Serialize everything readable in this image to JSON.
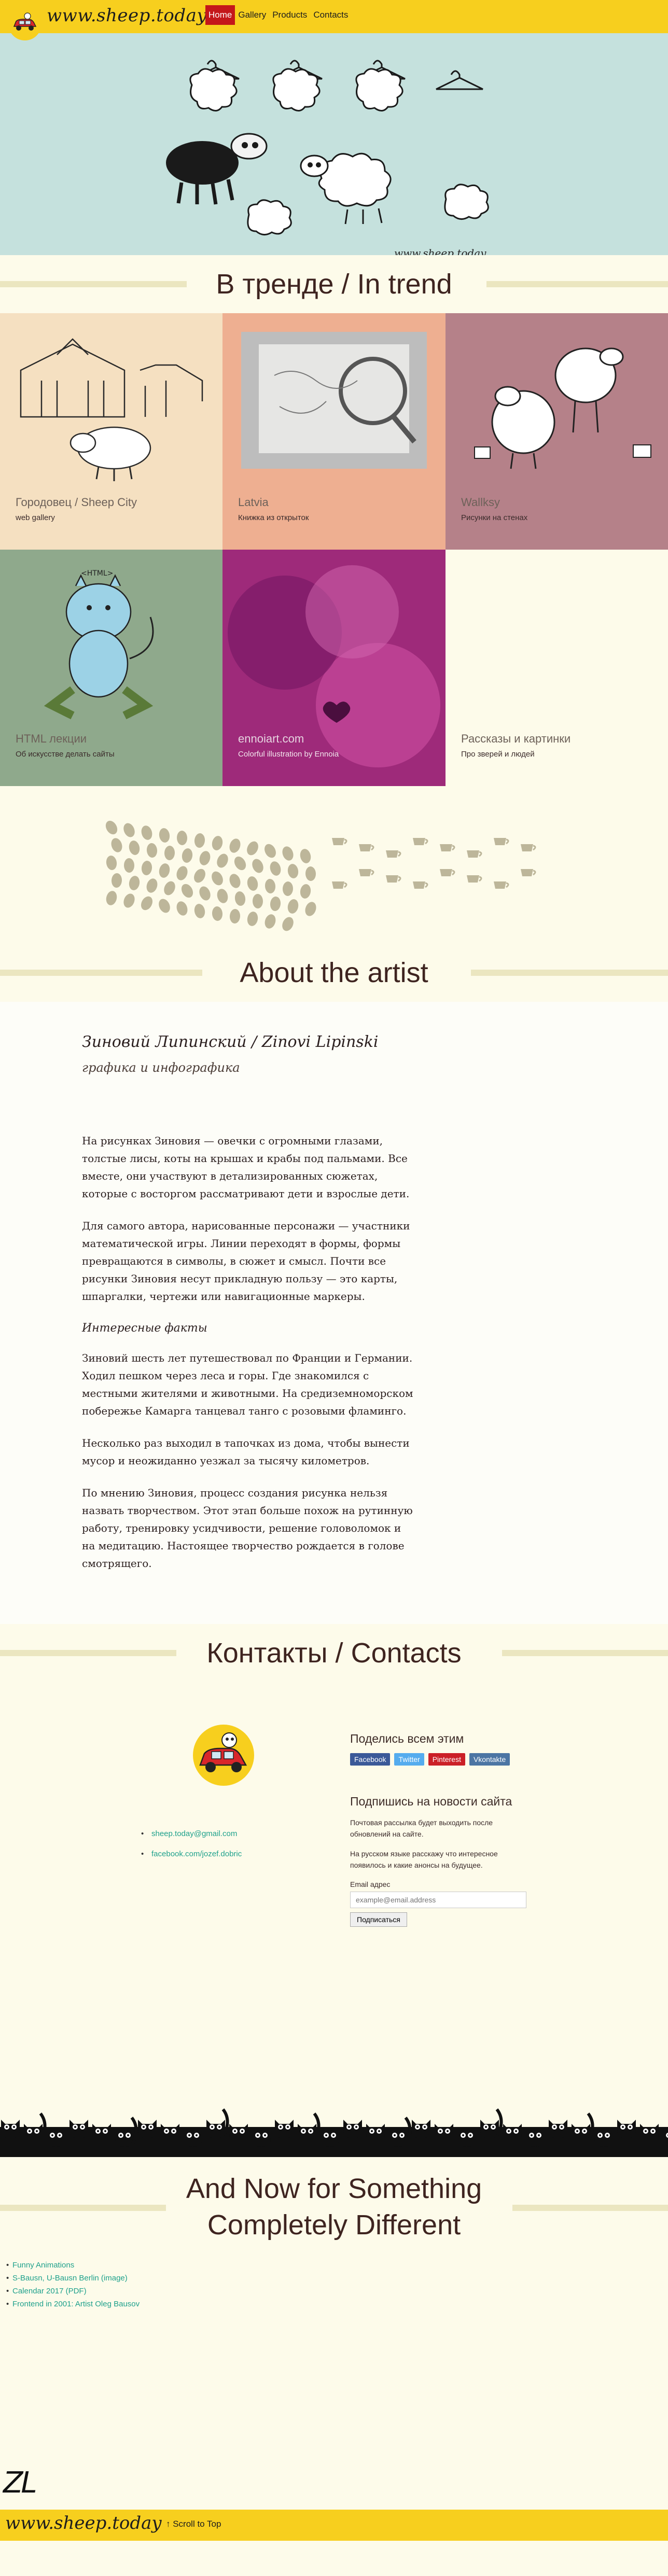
{
  "nav": {
    "logo": "www.sheep.today",
    "items": [
      {
        "label": "Home",
        "active": true
      },
      {
        "label": "Gallery",
        "active": false
      },
      {
        "label": "Products",
        "active": false
      },
      {
        "label": "Contacts",
        "active": false
      }
    ]
  },
  "hero": {
    "url_text": "www.sheep.today"
  },
  "trend": {
    "heading": "В тренде / In trend",
    "tiles": [
      {
        "title": "Городовец / Sheep City",
        "sub": "web gallery"
      },
      {
        "title": "Latvia",
        "sub": "Книжка из открыток"
      },
      {
        "title": "Wallksy",
        "sub": "Рисунки на стенах"
      },
      {
        "title": "HTML лекции",
        "sub": "Об искусстве делать сайты"
      },
      {
        "title": "ennoiart.com",
        "sub": "Colorful illustration by Ennoia"
      },
      {
        "title": "Рассказы и картинки",
        "sub": "Про зверей и людей"
      }
    ]
  },
  "about": {
    "heading": "About the artist",
    "name": "Зиновий Липинский / Zinovi Lipinski",
    "subtitle": "графика и инфографика",
    "p1": "На рисунках Зиновия — овечки с огромными глазами, толстые лисы, коты на крышах и крабы под пальмами. Все вместе, они участвуют в детализированных сюжетах, которые с восторгом рассматривают дети и взрослые дети.",
    "p2": "Для самого автора, нарисованные персонажи — участники математической игры. Линии переходят в формы, формы превращаются в символы, в сюжет и смысл. Почти все рисунки Зиновия несут прикладную пользу — это карты, шпаргалки, чертежи или навигационные маркеры.",
    "facts_heading": "Интересные факты",
    "p3": "Зиновий шесть лет путешествовал по Франции и Германии. Ходил пешком через леса и горы. Где знакомился с местными жителями и животными. На средиземноморском побережье Камарга танцевал танго с розовыми фламинго.",
    "p4": "Несколько раз выходил в тапочках из дома, чтобы вынести мусор и неожиданно уезжал за тысячу километров.",
    "p5": "По мнению Зиновия, процесс создания рисунка нельзя назвать творчеством. Этот этап больше похож на рутинную работу, тренировку усидчивости, решение головоломок и на медитацию. Настоящее творчество рождается в голове смотрящего."
  },
  "contacts": {
    "heading": "Контакты / Contacts",
    "links": [
      "sheep.today@gmail.com",
      "facebook.com/jozef.dobric"
    ],
    "share_heading": "Поделись всем этим",
    "share_buttons": {
      "fb": "Facebook",
      "tw": "Twitter",
      "pi": "Pinterest",
      "vk": "Vkontakte"
    },
    "subscribe_heading": "Подпишись на новости сайта",
    "note1": "Почтовая рассылка будет выходить после обновлений на сайте.",
    "note2": "На русском языке расскажу что интересное появилось и какие анонсы на будущее.",
    "email_label": "Email адрес",
    "email_placeholder": "example@email.address",
    "submit": "Подписаться"
  },
  "different": {
    "heading_line1": "And Now for Something",
    "heading_line2": "Completely Different",
    "links": [
      "Funny Animations",
      "S-Bausn, U-Bausn Berlin (image)",
      "Calendar 2017 (PDF)",
      "Frontend in 2001: Artist Oleg Bausov"
    ],
    "signature": "ZL"
  },
  "footer": {
    "logo": "www.sheep.today",
    "scroll_top": "↑ Scroll to Top"
  },
  "colors": {
    "accent_yellow": "#f7cf1e",
    "active_red": "#c4171a",
    "link_teal": "#1fa18c",
    "hero_bg": "#c5e1dd"
  }
}
